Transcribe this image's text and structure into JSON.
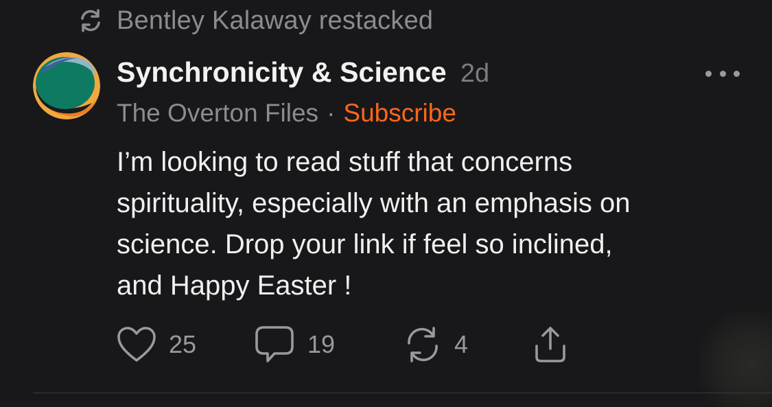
{
  "restack": {
    "icon": "restack-icon",
    "text": "Bentley Kalaway restacked"
  },
  "post": {
    "avatar": "publication-avatar",
    "title": "Synchronicity & Science",
    "age": "2d",
    "more_icon": "more-horizontal-icon",
    "author": "The Overton Files",
    "separator": "·",
    "subscribe_label": "Subscribe",
    "body": "I’m looking to read stuff that concerns\nspirituality, especially with an emphasis on\nscience.  Drop your link if feel so inclined,\nand Happy Easter !"
  },
  "actions": {
    "like": {
      "icon": "heart-icon",
      "count": "25"
    },
    "comment": {
      "icon": "comment-icon",
      "count": "19"
    },
    "restack": {
      "icon": "restack-icon",
      "count": "4"
    },
    "share": {
      "icon": "share-icon"
    }
  },
  "colors": {
    "background": "#18181a",
    "accent": "#ff6719",
    "text_primary": "#f2f2f2",
    "text_secondary": "#8c8c8f"
  }
}
